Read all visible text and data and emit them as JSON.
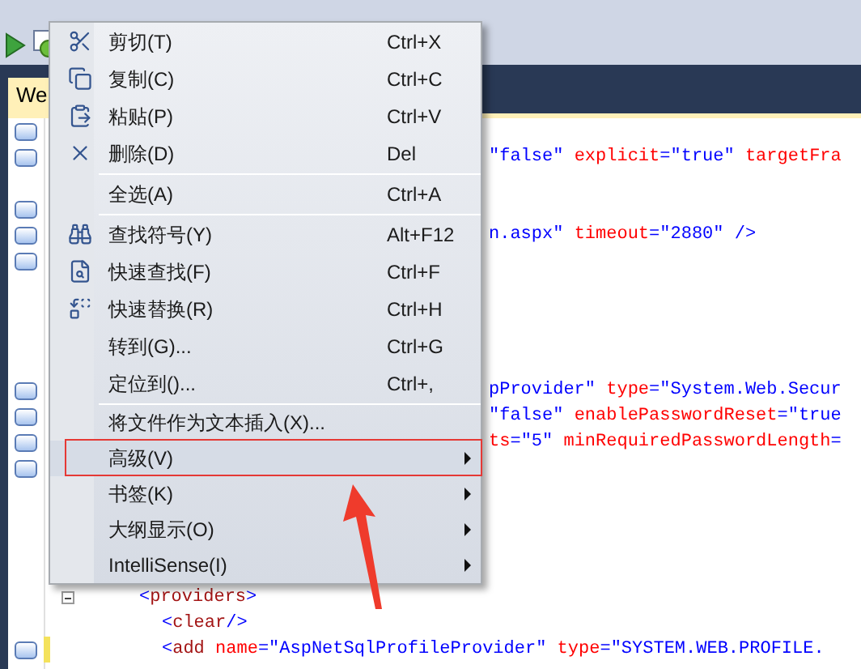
{
  "editor_tab": {
    "label": "We"
  },
  "code_lines": [
    {
      "bookmark": true
    },
    {
      "bookmark": true,
      "kind": "clipped",
      "segments": [
        {
          "kind": "value",
          "text": "\"false\""
        },
        {
          "kind": "attr",
          "text": " explicit"
        },
        {
          "kind": "punct",
          "text": "="
        },
        {
          "kind": "value",
          "text": "\"true\""
        },
        {
          "kind": "attr",
          "text": " targetFra"
        }
      ]
    },
    {
      "bookmark": false
    },
    {
      "bookmark": true
    },
    {
      "bookmark": true,
      "kind": "clipped",
      "segments": [
        {
          "kind": "value",
          "text": "n.aspx\""
        },
        {
          "kind": "attr",
          "text": " timeout"
        },
        {
          "kind": "punct",
          "text": "="
        },
        {
          "kind": "value",
          "text": "\"2880\""
        },
        {
          "kind": "punct",
          "text": " />"
        }
      ]
    },
    {
      "bookmark": true
    },
    {
      "bookmark": false
    },
    {
      "bookmark": false
    },
    {
      "bookmark": false
    },
    {
      "bookmark": false
    },
    {
      "bookmark": true,
      "kind": "clipped",
      "segments": [
        {
          "kind": "value",
          "text": "pProvider\""
        },
        {
          "kind": "attr",
          "text": " type"
        },
        {
          "kind": "punct",
          "text": "="
        },
        {
          "kind": "value",
          "text": "\"System.Web.Secur"
        }
      ]
    },
    {
      "bookmark": true,
      "kind": "clipped",
      "segments": [
        {
          "kind": "value",
          "text": "\"false\""
        },
        {
          "kind": "attr",
          "text": " enablePasswordReset"
        },
        {
          "kind": "punct",
          "text": "="
        },
        {
          "kind": "value",
          "text": "\"true"
        }
      ]
    },
    {
      "bookmark": true,
      "kind": "clipped",
      "segments": [
        {
          "kind": "attr",
          "text": "ts"
        },
        {
          "kind": "punct",
          "text": "="
        },
        {
          "kind": "value",
          "text": "\"5\""
        },
        {
          "kind": "attr",
          "text": " minRequiredPasswordLength"
        },
        {
          "kind": "punct",
          "text": "="
        }
      ]
    },
    {
      "bookmark": true
    },
    {
      "bookmark": false
    },
    {
      "bookmark": false
    },
    {
      "bookmark": false
    },
    {
      "bookmark": false
    },
    {
      "bookmark": false,
      "kind": "open",
      "collapsible": true,
      "segments": [
        {
          "kind": "punct",
          "text": "<"
        },
        {
          "kind": "tag",
          "text": "providers"
        },
        {
          "kind": "punct",
          "text": ">"
        }
      ],
      "children": [
        {
          "bookmark": false,
          "kind": "open",
          "segments": [
            {
              "kind": "punct",
              "text": "<"
            },
            {
              "kind": "tag",
              "text": "clear"
            },
            {
              "kind": "punct",
              "text": "/>"
            }
          ]
        },
        {
          "bookmark": true,
          "changed": true,
          "kind": "open",
          "segments": [
            {
              "kind": "punct",
              "text": "<"
            },
            {
              "kind": "tag",
              "text": "add"
            },
            {
              "kind": "attr",
              "text": " name"
            },
            {
              "kind": "punct",
              "text": "="
            },
            {
              "kind": "value",
              "text": "\"AspNetSqlProfileProvider\""
            },
            {
              "kind": "attr",
              "text": " type"
            },
            {
              "kind": "punct",
              "text": "="
            },
            {
              "kind": "value",
              "text": "\"SYSTEM.WEB.PROFILE."
            }
          ]
        }
      ]
    }
  ],
  "context_menu": {
    "groups": [
      [
        {
          "label": "剪切(T)",
          "shortcut": "Ctrl+X",
          "kind": "command"
        },
        {
          "label": "复制(C)",
          "shortcut": "Ctrl+C",
          "kind": "command"
        },
        {
          "label": "粘贴(P)",
          "shortcut": "Ctrl+V",
          "kind": "command"
        },
        {
          "label": "删除(D)",
          "shortcut": "Del",
          "kind": "command"
        }
      ],
      [
        {
          "label": "全选(A)",
          "shortcut": "Ctrl+A",
          "kind": "command"
        }
      ],
      [
        {
          "label": "查找符号(Y)",
          "shortcut": "Alt+F12",
          "kind": "command"
        },
        {
          "label": "快速查找(F)",
          "shortcut": "Ctrl+F",
          "kind": "command"
        },
        {
          "label": "快速替换(R)",
          "shortcut": "Ctrl+H",
          "kind": "command"
        },
        {
          "label": "转到(G)...",
          "shortcut": "Ctrl+G",
          "kind": "command"
        },
        {
          "label": "定位到()...",
          "shortcut": "Ctrl+,",
          "kind": "command"
        }
      ],
      [
        {
          "label": "将文件作为文本插入(X)...",
          "kind": "command"
        },
        {
          "label": "高级(V)",
          "kind": "submenu",
          "highlighted": true
        },
        {
          "label": "书签(K)",
          "kind": "submenu",
          "highlighted": false
        },
        {
          "label": "大纲显示(O)",
          "kind": "submenu",
          "highlighted": false
        },
        {
          "label": "IntelliSense(I)",
          "kind": "submenu",
          "highlighted": false
        }
      ]
    ]
  }
}
